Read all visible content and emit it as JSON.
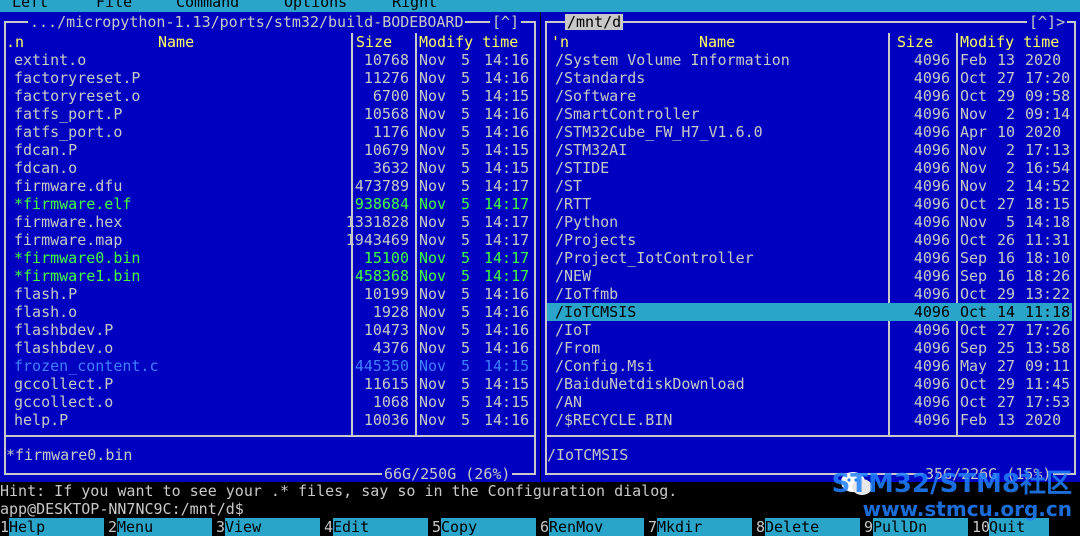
{
  "menu": {
    "left": "Left",
    "file": "File",
    "command": "Command",
    "options": "Options",
    "right": "Right"
  },
  "left_panel": {
    "path": ".../micropython-1.13/ports/stm32/build-BODEBOARD",
    "controls": "[^]",
    "header": {
      "sort": ".n",
      "name": "Name",
      "size": "Size",
      "modify": "Modify time"
    },
    "rows": [
      {
        "name": "extint.o",
        "size": "10768",
        "mon": "Nov",
        "day": "5",
        "time": "14:16",
        "k": ""
      },
      {
        "name": "factoryreset.P",
        "size": "11276",
        "mon": "Nov",
        "day": "5",
        "time": "14:16",
        "k": ""
      },
      {
        "name": "factoryreset.o",
        "size": "6700",
        "mon": "Nov",
        "day": "5",
        "time": "14:15",
        "k": ""
      },
      {
        "name": "fatfs_port.P",
        "size": "10568",
        "mon": "Nov",
        "day": "5",
        "time": "14:16",
        "k": ""
      },
      {
        "name": "fatfs_port.o",
        "size": "1176",
        "mon": "Nov",
        "day": "5",
        "time": "14:16",
        "k": ""
      },
      {
        "name": "fdcan.P",
        "size": "10679",
        "mon": "Nov",
        "day": "5",
        "time": "14:15",
        "k": ""
      },
      {
        "name": "fdcan.o",
        "size": "3632",
        "mon": "Nov",
        "day": "5",
        "time": "14:15",
        "k": ""
      },
      {
        "name": "firmware.dfu",
        "size": "473789",
        "mon": "Nov",
        "day": "5",
        "time": "14:17",
        "k": ""
      },
      {
        "name": "*firmware.elf",
        "size": "938684",
        "mon": "Nov",
        "day": "5",
        "time": "14:17",
        "k": "exe"
      },
      {
        "name": "firmware.hex",
        "size": "1331828",
        "mon": "Nov",
        "day": "5",
        "time": "14:17",
        "k": ""
      },
      {
        "name": "firmware.map",
        "size": "1943469",
        "mon": "Nov",
        "day": "5",
        "time": "14:17",
        "k": ""
      },
      {
        "name": "*firmware0.bin",
        "size": "15100",
        "mon": "Nov",
        "day": "5",
        "time": "14:17",
        "k": "exe"
      },
      {
        "name": "*firmware1.bin",
        "size": "458368",
        "mon": "Nov",
        "day": "5",
        "time": "14:17",
        "k": "exe"
      },
      {
        "name": "flash.P",
        "size": "10199",
        "mon": "Nov",
        "day": "5",
        "time": "14:16",
        "k": ""
      },
      {
        "name": "flash.o",
        "size": "1928",
        "mon": "Nov",
        "day": "5",
        "time": "14:16",
        "k": ""
      },
      {
        "name": "flashbdev.P",
        "size": "10473",
        "mon": "Nov",
        "day": "5",
        "time": "14:16",
        "k": ""
      },
      {
        "name": "flashbdev.o",
        "size": "4376",
        "mon": "Nov",
        "day": "5",
        "time": "14:16",
        "k": ""
      },
      {
        "name": "frozen_content.c",
        "size": "445350",
        "mon": "Nov",
        "day": "5",
        "time": "14:15",
        "k": "dim"
      },
      {
        "name": "gccollect.P",
        "size": "11615",
        "mon": "Nov",
        "day": "5",
        "time": "14:15",
        "k": ""
      },
      {
        "name": "gccollect.o",
        "size": "1068",
        "mon": "Nov",
        "day": "5",
        "time": "14:15",
        "k": ""
      },
      {
        "name": "help.P",
        "size": "10036",
        "mon": "Nov",
        "day": "5",
        "time": "14:16",
        "k": ""
      }
    ],
    "status": "*firmware0.bin",
    "free": "66G/250G (26%)"
  },
  "right_panel": {
    "path": "/mnt/d",
    "controls": "[^]>",
    "header": {
      "sort": "'n",
      "name": "Name",
      "size": "Size",
      "modify": "Modify time"
    },
    "rows": [
      {
        "name": "/System Volume Information",
        "size": "4096",
        "mon": "Feb",
        "day": "13",
        "time": "2020",
        "k": ""
      },
      {
        "name": "/Standards",
        "size": "4096",
        "mon": "Oct",
        "day": "27",
        "time": "17:20",
        "k": ""
      },
      {
        "name": "/Software",
        "size": "4096",
        "mon": "Oct",
        "day": "29",
        "time": "09:58",
        "k": ""
      },
      {
        "name": "/SmartController",
        "size": "4096",
        "mon": "Nov",
        "day": "2",
        "time": "09:14",
        "k": ""
      },
      {
        "name": "/STM32Cube_FW_H7_V1.6.0",
        "size": "4096",
        "mon": "Apr",
        "day": "10",
        "time": "2020",
        "k": ""
      },
      {
        "name": "/STM32AI",
        "size": "4096",
        "mon": "Nov",
        "day": "2",
        "time": "17:13",
        "k": ""
      },
      {
        "name": "/STIDE",
        "size": "4096",
        "mon": "Nov",
        "day": "2",
        "time": "16:54",
        "k": ""
      },
      {
        "name": "/ST",
        "size": "4096",
        "mon": "Nov",
        "day": "2",
        "time": "14:52",
        "k": ""
      },
      {
        "name": "/RTT",
        "size": "4096",
        "mon": "Oct",
        "day": "27",
        "time": "18:15",
        "k": ""
      },
      {
        "name": "/Python",
        "size": "4096",
        "mon": "Nov",
        "day": "5",
        "time": "14:18",
        "k": ""
      },
      {
        "name": "/Projects",
        "size": "4096",
        "mon": "Oct",
        "day": "26",
        "time": "11:31",
        "k": ""
      },
      {
        "name": "/Project_IotController",
        "size": "4096",
        "mon": "Sep",
        "day": "16",
        "time": "18:10",
        "k": ""
      },
      {
        "name": "/NEW",
        "size": "4096",
        "mon": "Sep",
        "day": "16",
        "time": "18:26",
        "k": ""
      },
      {
        "name": "/IoTfmb",
        "size": "4096",
        "mon": "Oct",
        "day": "29",
        "time": "13:22",
        "k": ""
      },
      {
        "name": "/IoTCMSIS",
        "size": "4096",
        "mon": "Oct",
        "day": "14",
        "time": "11:18",
        "k": "sel"
      },
      {
        "name": "/IoT",
        "size": "4096",
        "mon": "Oct",
        "day": "27",
        "time": "17:26",
        "k": ""
      },
      {
        "name": "/From",
        "size": "4096",
        "mon": "Sep",
        "day": "25",
        "time": "13:58",
        "k": ""
      },
      {
        "name": "/Config.Msi",
        "size": "4096",
        "mon": "May",
        "day": "27",
        "time": "09:11",
        "k": ""
      },
      {
        "name": "/BaiduNetdiskDownload",
        "size": "4096",
        "mon": "Oct",
        "day": "29",
        "time": "11:45",
        "k": ""
      },
      {
        "name": "/AN",
        "size": "4096",
        "mon": "Oct",
        "day": "27",
        "time": "17:53",
        "k": ""
      },
      {
        "name": "/$RECYCLE.BIN",
        "size": "4096",
        "mon": "Feb",
        "day": "13",
        "time": "2020",
        "k": ""
      }
    ],
    "status": "/IoTCMSIS",
    "free": "35G/226G (15%)"
  },
  "hint": "Hint: If you want to see your .* files, say so in the Configuration dialog.",
  "prompt": "app@DESKTOP-NN7NC9C:/mnt/d$",
  "fkeys": [
    {
      "n": "1",
      "label": "Help"
    },
    {
      "n": "2",
      "label": "Menu"
    },
    {
      "n": "3",
      "label": "View"
    },
    {
      "n": "4",
      "label": "Edit"
    },
    {
      "n": "5",
      "label": "Copy"
    },
    {
      "n": "6",
      "label": "RenMov"
    },
    {
      "n": "7",
      "label": "Mkdir"
    },
    {
      "n": "8",
      "label": "Delete"
    },
    {
      "n": "9",
      "label": "PullDn"
    },
    {
      "n": "10",
      "label": "Quit"
    }
  ],
  "watermark": {
    "line1": "STM32/STM8社区",
    "line2": "www.stmcu.org.cn"
  },
  "colors": {
    "panel_bg": "#0000c0",
    "selection": "#2aa4c8",
    "executable": "#40ff40",
    "header": "#ffff60"
  }
}
